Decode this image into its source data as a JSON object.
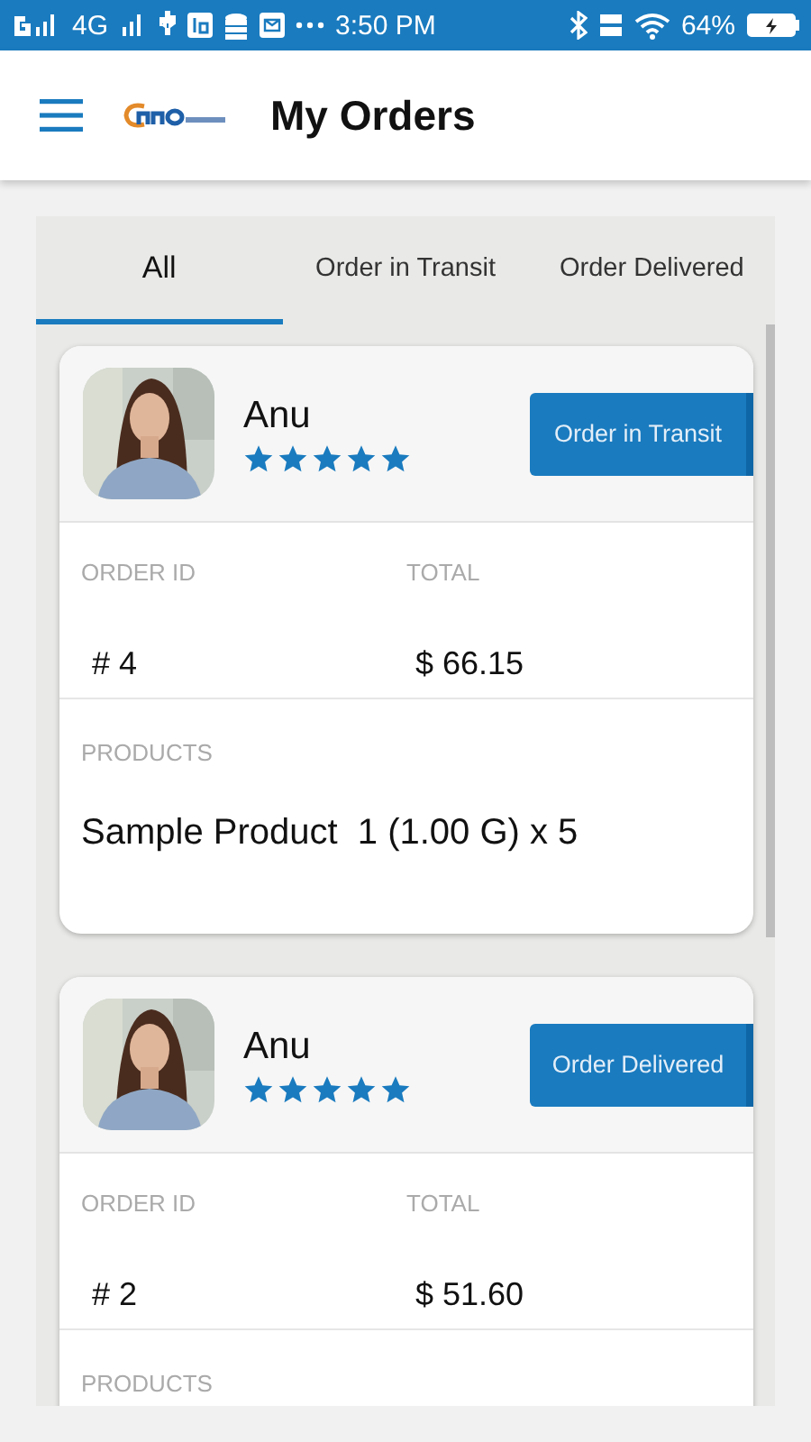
{
  "status_bar": {
    "network": "4G",
    "time": "3:50 PM",
    "battery": "64%"
  },
  "header": {
    "title": "My Orders"
  },
  "tabs": [
    {
      "label": "All",
      "selected": true
    },
    {
      "label": "Order in Transit",
      "selected": false
    },
    {
      "label": "Order Delivered",
      "selected": false
    }
  ],
  "orders": [
    {
      "customer": "Anu",
      "stars": 5,
      "status": "Order in Transit",
      "order_id_label": "ORDER ID",
      "order_id": "# 4",
      "total_label": "TOTAL",
      "total": "$ 66.15",
      "products_label": "PRODUCTS",
      "products": "Sample Product  1 (1.00 G) x 5"
    },
    {
      "customer": "Anu",
      "stars": 5,
      "status": "Order Delivered",
      "order_id_label": "ORDER ID",
      "order_id": "# 2",
      "total_label": "TOTAL",
      "total": "$ 51.60",
      "products_label": "PRODUCTS"
    }
  ]
}
